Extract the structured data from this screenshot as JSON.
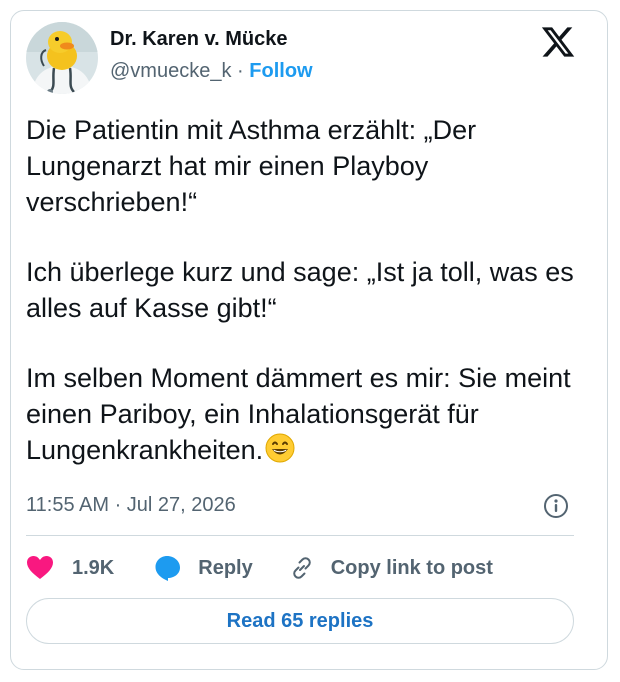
{
  "author": {
    "name": "Dr. Karen v. Mücke",
    "handle": "@vmuecke_k",
    "separator": "·",
    "follow_label": "Follow",
    "avatar_icon": "duck-doctor-avatar-icon"
  },
  "brand": {
    "logo_icon": "x-logo-icon"
  },
  "tweet": {
    "paragraphs": [
      "Die Patientin mit Asthma erzählt: „Der Lungenarzt hat mir einen Playboy verschrieben!“",
      "Ich überlege kurz und sage: „Ist ja toll, was es alles auf Kasse gibt!“",
      "Im selben Moment dämmert es mir: Sie meint einen Pariboy, ein Inhalationsgerät für Lungenkrankheiten."
    ],
    "emoji_icon": "grinning-face-emoji-icon",
    "timestamp": "11:55 AM · Jul 27, 2026"
  },
  "actions": {
    "like_count": "1.9K",
    "reply_label": "Reply",
    "copy_label": "Copy link to post",
    "read_replies_label": "Read 65 replies"
  },
  "colors": {
    "like": "#f91880",
    "reply": "#1d9bf0",
    "follow": "#1d9bf0",
    "secondary_text": "#536471",
    "border": "#cfd9de"
  }
}
